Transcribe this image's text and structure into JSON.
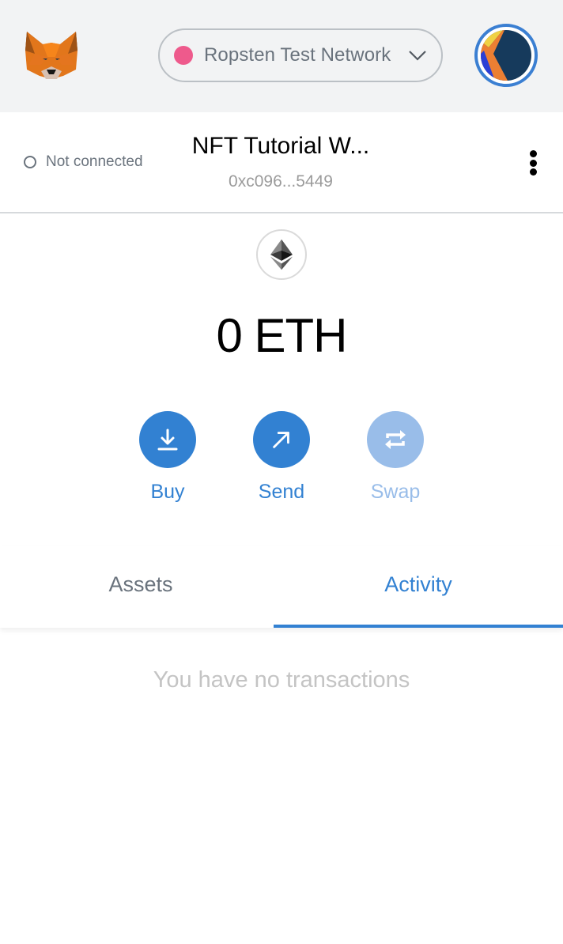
{
  "header": {
    "logo": "metamask-fox-icon",
    "network": {
      "label": "Ropsten Test Network",
      "dot_color": "#ee5a8c",
      "chevron": "chevron-down-icon"
    },
    "account_avatar": "identicon-avatar"
  },
  "account": {
    "connection_status": "Not connected",
    "name": "NFT Tutorial W...",
    "address": "0xc096...5449",
    "menu_icon": "kebab-menu-icon"
  },
  "balance": {
    "icon": "ethereum-icon",
    "amount": "0",
    "currency": "ETH",
    "display": "0 ETH"
  },
  "actions": [
    {
      "label": "Buy",
      "icon": "download-icon",
      "enabled": true
    },
    {
      "label": "Send",
      "icon": "arrow-up-right-icon",
      "enabled": true
    },
    {
      "label": "Swap",
      "icon": "swap-icon",
      "enabled": false
    }
  ],
  "tabs": [
    {
      "label": "Assets",
      "active": false
    },
    {
      "label": "Activity",
      "active": true
    }
  ],
  "activity": {
    "empty_message": "You have no transactions"
  },
  "colors": {
    "primary": "#3281d2",
    "primary_disabled": "#99bde9",
    "header_bg": "#f2f3f4",
    "muted_text": "#6a737d"
  }
}
